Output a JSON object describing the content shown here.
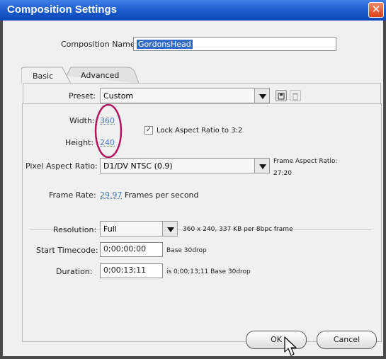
{
  "window": {
    "title": "Composition Settings",
    "close_icon": "close-icon"
  },
  "composition_name": {
    "label": "Composition Name:",
    "value": "GordonsHead"
  },
  "tabs": [
    {
      "label": "Basic",
      "active": true
    },
    {
      "label": "Advanced",
      "active": false
    }
  ],
  "preset": {
    "label": "Preset:",
    "value": "Custom"
  },
  "width": {
    "label": "Width:",
    "value": "360"
  },
  "height": {
    "label": "Height:",
    "value": "240"
  },
  "lock_aspect": {
    "label": "Lock Aspect Ratio to 3:2",
    "checked": true
  },
  "pixel_aspect": {
    "label": "Pixel Aspect Ratio:",
    "value": "D1/DV NTSC (0.9)"
  },
  "frame_aspect": {
    "label": "Frame Aspect Ratio:",
    "value": "27:20"
  },
  "frame_rate": {
    "label": "Frame Rate:",
    "value": "29.97",
    "unit": "Frames per second"
  },
  "resolution": {
    "label": "Resolution:",
    "value": "Full",
    "info": "360 x 240, 337 KB per 8bpc frame"
  },
  "start_timecode": {
    "label": "Start Timecode:",
    "value": "0;00;00;00",
    "info": "Base 30drop"
  },
  "duration": {
    "label": "Duration:",
    "value": "0;00;13;11",
    "info": "is 0;00;13;11  Base 30drop"
  },
  "buttons": {
    "ok": "OK",
    "cancel": "Cancel"
  },
  "colors": {
    "annotation_circle": "#b0155e",
    "title_bar": "#1f5fcf"
  }
}
